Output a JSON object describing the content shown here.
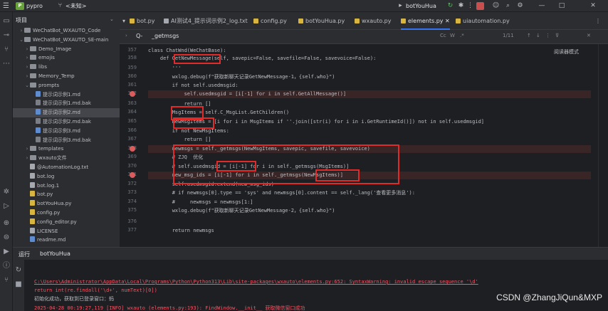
{
  "titlebar": {
    "project": "pypro",
    "vcs": "<未知>",
    "run_config": "botYouHua",
    "menu_icon": "hamburger-icon"
  },
  "project_panel": {
    "title": "项目",
    "items": [
      {
        "label": "WeChatBot_WXAUTO_Code",
        "type": "folder",
        "depth": 1,
        "expanded": false
      },
      {
        "label": "WeChatBot_WXAUTO_SE-main",
        "type": "folder",
        "depth": 1,
        "expanded": true
      },
      {
        "label": "Demo_Image",
        "type": "folder",
        "depth": 2,
        "expanded": false
      },
      {
        "label": "emojis",
        "type": "folder",
        "depth": 2,
        "expanded": false
      },
      {
        "label": "libs",
        "type": "folder",
        "depth": 2,
        "expanded": false
      },
      {
        "label": "Memory_Temp",
        "type": "folder",
        "depth": 2,
        "expanded": false
      },
      {
        "label": "prompts",
        "type": "folder",
        "depth": 2,
        "expanded": true
      },
      {
        "label": "提示词示例1.md",
        "type": "md",
        "depth": 3
      },
      {
        "label": "提示词示例1.md.bak",
        "type": "bak",
        "depth": 3
      },
      {
        "label": "提示词示例2.md",
        "type": "md",
        "depth": 3,
        "selected": true
      },
      {
        "label": "提示词示例2.md.bak",
        "type": "bak",
        "depth": 3
      },
      {
        "label": "提示词示例3.md",
        "type": "md",
        "depth": 3
      },
      {
        "label": "提示词示例3.md.bak",
        "type": "bak",
        "depth": 3
      },
      {
        "label": "templates",
        "type": "folder",
        "depth": 2,
        "expanded": false
      },
      {
        "label": "wxauto文件",
        "type": "folder",
        "depth": 2,
        "expanded": false
      },
      {
        "label": "@AutomationLog.txt",
        "type": "txt",
        "depth": 2
      },
      {
        "label": "bot.log",
        "type": "txt",
        "depth": 2
      },
      {
        "label": "bot.log.1",
        "type": "txt",
        "depth": 2
      },
      {
        "label": "bot.py",
        "type": "py",
        "depth": 2
      },
      {
        "label": "botYouHua.py",
        "type": "py",
        "depth": 2
      },
      {
        "label": "config.py",
        "type": "py",
        "depth": 2
      },
      {
        "label": "config_editor.py",
        "type": "py",
        "depth": 2
      },
      {
        "label": "LICENSE",
        "type": "txt",
        "depth": 2
      },
      {
        "label": "readme.md",
        "type": "md",
        "depth": 2
      }
    ]
  },
  "tabs": [
    {
      "label": "bot.py",
      "icon": "py"
    },
    {
      "label": "AI测试4_提示词示例2_log.txt",
      "icon": "txt"
    },
    {
      "label": "config.py",
      "icon": "py"
    },
    {
      "label": "botYouHua.py",
      "icon": "py"
    },
    {
      "label": "wxauto.py",
      "icon": "py"
    },
    {
      "label": "elements.py",
      "icon": "py",
      "active": true
    },
    {
      "label": "uiautomation.py",
      "icon": "py"
    }
  ],
  "find": {
    "prefix": "Q-",
    "term": "_getmsgs",
    "options": [
      "Cc",
      "W",
      ".*"
    ],
    "count": "1/11"
  },
  "editor": {
    "reader_mode": "阅读器模式",
    "lines": [
      {
        "num": "357",
        "text": "class ChatWnd(WeChatBase):",
        "bp": false,
        "hl": false
      },
      {
        "num": "358",
        "text": "    def GetNewMessage(self, savepic=False, savefile=False, savevoice=False):",
        "bp": false,
        "hl": false
      },
      {
        "num": "359",
        "text": "        '''",
        "bp": false,
        "hl": false
      },
      {
        "num": "360",
        "text": "        wxlog.debug(f\"获取新聊天记录GetNewMessage-1，{self.who}\")",
        "bp": false,
        "hl": false
      },
      {
        "num": "361",
        "text": "        if not self.usedmsgid:",
        "bp": false,
        "hl": false
      },
      {
        "num": "362",
        "text": "            self.usedmsgid = [i[-1] for i in self.GetAllMessage()]",
        "bp": true,
        "hl": true
      },
      {
        "num": "363",
        "text": "            return []",
        "bp": false,
        "hl": false
      },
      {
        "num": "364",
        "text": "        MsgItems = self.C_MsgList.GetChildren()",
        "bp": false,
        "hl": false
      },
      {
        "num": "365",
        "text": "        NewMsgItems = [i for i in MsgItems if ''.join([str(i) for i in i.GetRuntimeId()]) not in self.usedmsgid]",
        "bp": false,
        "hl": false
      },
      {
        "num": "366",
        "text": "        if not NewMsgItems:",
        "bp": false,
        "hl": false
      },
      {
        "num": "367",
        "text": "            return []",
        "bp": false,
        "hl": false
      },
      {
        "num": "368",
        "text": "        newmsgs = self._getmsgs(NewMsgItems, savepic, savefile, savevoice)",
        "bp": true,
        "hl": true
      },
      {
        "num": "369",
        "text": "        # ZJQ  优化",
        "bp": false,
        "hl": false
      },
      {
        "num": "370",
        "text": "        # self.usedmsgid = [i[-1] for i in self._getmsgs(MsgItems)]",
        "bp": false,
        "hl": false
      },
      {
        "num": "371",
        "text": "        new_msg_ids = [i[-1] for i in self._getmsgs(NewMsgItems)]",
        "bp": true,
        "hl": true
      },
      {
        "num": "372",
        "text": "        self.usedmsgid.extend(new_msg_ids)",
        "bp": false,
        "hl": false
      },
      {
        "num": "373",
        "text": "        # if newmsgs[0].type == 'sys' and newmsgs[0].content == self._lang('查看更多消息'):",
        "bp": false,
        "hl": false
      },
      {
        "num": "374",
        "text": "        #     newmsgs = newmsgs[1:]",
        "bp": false,
        "hl": false
      },
      {
        "num": "375",
        "text": "        wxlog.debug(f\"获取新聊天记录GetNewMessage-2，{self.who}\")",
        "bp": false,
        "hl": false
      },
      {
        "num": "376",
        "text": "",
        "bp": false,
        "hl": false
      },
      {
        "num": "377",
        "text": "        return newmsgs",
        "bp": false,
        "hl": false
      }
    ]
  },
  "run": {
    "title": "运行",
    "tab": "botYouHua",
    "console": [
      {
        "text": "C:\\Users\\Administrator\\AppData\\Local\\Programs\\Python\\Python313\\Lib\\site-packages\\wxauto\\elements.py:652: SyntaxWarning: invalid escape sequence '\\d'",
        "color": "#f75464",
        "link": true
      },
      {
        "text": "  return int(re.findall('\\d+', numText)[0])",
        "color": "#f75464"
      },
      {
        "text": "初始化成功，获取到已登录窗口：蚂",
        "color": "#bcbec4"
      },
      {
        "text": "2025-04-28 00:19:27,119 [INFO] wxauto (elements.py:193): FindWindow.__init__ 获取微信窗口成功",
        "color": "#f75464"
      }
    ]
  },
  "watermark": "CSDN @ZhangJiQun&MXP"
}
